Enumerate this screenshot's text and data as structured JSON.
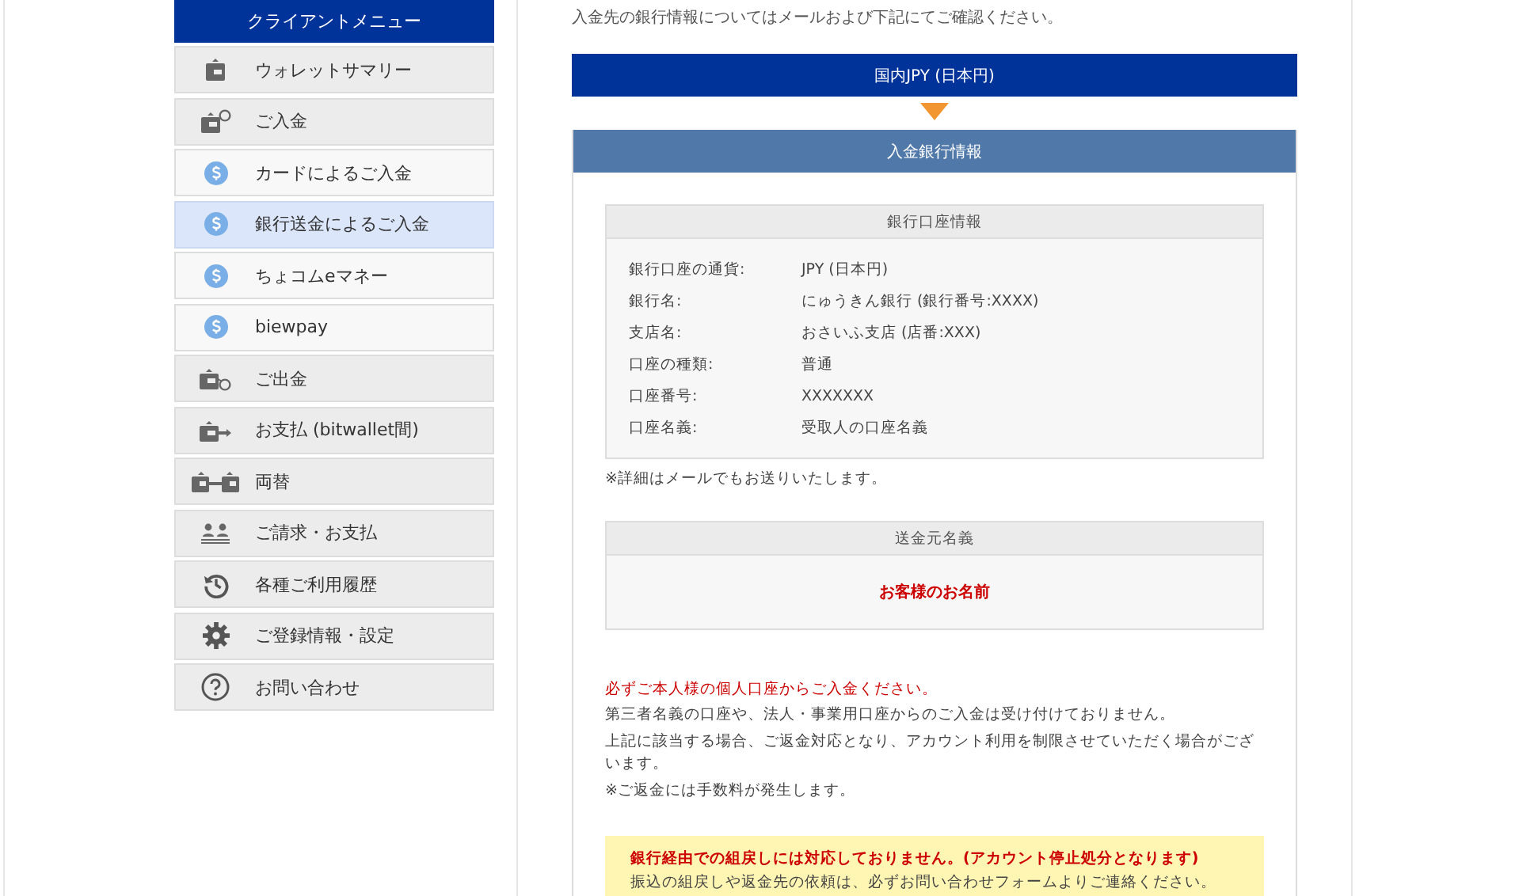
{
  "sidebar": {
    "title": "クライアントメニュー",
    "items": [
      {
        "label": "ウォレットサマリー",
        "kind": "main",
        "selected": false
      },
      {
        "label": "ご入金",
        "kind": "main",
        "selected": false
      },
      {
        "label": "カードによるご入金",
        "kind": "sub",
        "selected": false
      },
      {
        "label": "銀行送金によるご入金",
        "kind": "sub",
        "selected": true
      },
      {
        "label": "ちょコムeマネー",
        "kind": "sub",
        "selected": false
      },
      {
        "label": "biewpay",
        "kind": "sub",
        "selected": false
      },
      {
        "label": "ご出金",
        "kind": "main",
        "selected": false
      },
      {
        "label": "お支払 (bitwallet間)",
        "kind": "main",
        "selected": false
      },
      {
        "label": "両替",
        "kind": "main",
        "selected": false
      },
      {
        "label": "ご請求・お支払",
        "kind": "main",
        "selected": false
      },
      {
        "label": "各種ご利用履歴",
        "kind": "main",
        "selected": false
      },
      {
        "label": "ご登録情報・設定",
        "kind": "main",
        "selected": false
      },
      {
        "label": "お問い合わせ",
        "kind": "main",
        "selected": false
      }
    ]
  },
  "main": {
    "intro": "入金先の銀行情報についてはメールおよび下記にてご確認ください。",
    "currency_bar": "国内JPY (日本円)",
    "panel_title": "入金銀行情報",
    "account": {
      "title": "銀行口座情報",
      "rows": [
        {
          "label": "銀行口座の通貨:",
          "value": "JPY (日本円)"
        },
        {
          "label": "銀行名:",
          "value": "にゅうきん銀行 (銀行番号:XXXX)"
        },
        {
          "label": "支店名:",
          "value": "おさいふ支店 (店番:XXX)"
        },
        {
          "label": "口座の種類:",
          "value": "普通"
        },
        {
          "label": "口座番号:",
          "value": "XXXXXXX"
        },
        {
          "label": "口座名義:",
          "value": "受取人の口座名義"
        }
      ]
    },
    "account_note": "※詳細はメールでもお送りいたします。",
    "sender": {
      "title": "送金元名義",
      "value": "お客様のお名前"
    },
    "warning": "必ずご本人様の個人口座からご入金ください。",
    "notes": [
      "第三者名義の口座や、法人・事業用口座からのご入金は受け付けておりません。",
      "上記に該当する場合、ご返金対応となり、アカウント利用を制限させていただく場合がございます。",
      "※ご返金には手数料が発生します。"
    ],
    "alert": {
      "title": "銀行経由での組戻しには対応しておりません。(アカウント停止処分となります)",
      "text": "振込の組戻しや返金先の依頼は、必ずお問い合わせフォームよりご連絡ください。"
    }
  }
}
